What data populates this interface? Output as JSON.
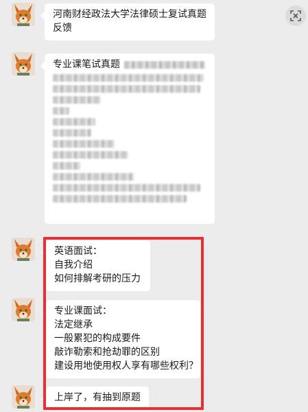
{
  "messages": [
    {
      "lines": [
        "河南财经政法大学法律硕士复试真题",
        "反馈"
      ]
    },
    {
      "lines": [
        "专业课笔试真题"
      ]
    },
    {
      "lines": [
        "英语面试：",
        "自我介绍",
        "如何排解考研的压力"
      ]
    },
    {
      "lines": [
        "专业课面试：",
        "法定继承",
        "一般累犯的构成要件",
        "敲诈勒索和抢劫罪的区别",
        "建设用地使用权人享有哪些权利？"
      ]
    },
    {
      "lines": [
        "上岸了，有抽到原题"
      ]
    }
  ],
  "icons": {
    "corner_button": "scan-icon",
    "avatar": "fox-avatar"
  },
  "colors": {
    "background": "#ececec",
    "bubble": "#ffffff",
    "highlight_border": "#ee2c33"
  }
}
